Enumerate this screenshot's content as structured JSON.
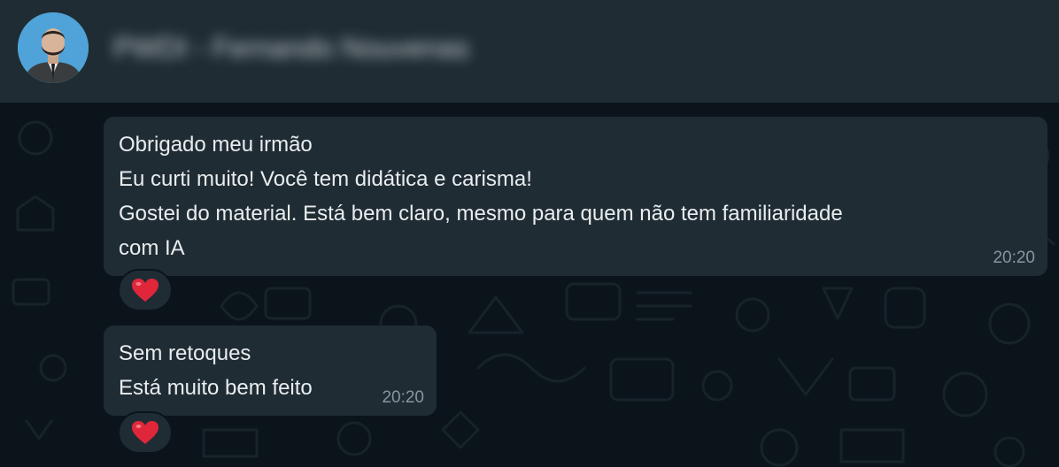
{
  "header": {
    "contact_name": "PWDI - Fernando Nouvenas"
  },
  "messages": [
    {
      "lines": [
        "Obrigado meu irmão",
        "Eu curti muito! Você tem didática e carisma!",
        "Gostei do material. Está bem claro, mesmo para quem não tem familiaridade",
        "com IA"
      ],
      "time": "20:20",
      "reaction": "heart"
    },
    {
      "lines": [
        "Sem retoques",
        "Está muito bem feito"
      ],
      "time": "20:20",
      "reaction": "heart"
    }
  ],
  "colors": {
    "header_bg": "#1f2c33",
    "chat_bg": "#0b141a",
    "bubble_bg": "#202c33",
    "text": "#e9edef",
    "meta": "#8696a0",
    "heart": "#e0263a"
  }
}
